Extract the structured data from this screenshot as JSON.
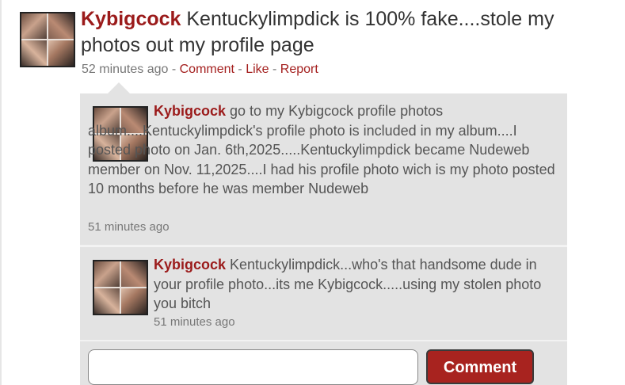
{
  "post": {
    "author": "Kybigcock",
    "text": " Kentuckylimpdick is 100% fake....stole my photos out my profile page",
    "time": "52 minutes ago",
    "sep": " - ",
    "actions": {
      "comment": "Comment",
      "like": "Like",
      "report": "Report"
    }
  },
  "comments": [
    {
      "author": "Kybigcock",
      "text": " go to my Kybigcock profile photos album....Kentuckylimpdick's profile photo is included in my album....I posted photo on Jan. 6th,2025.....Kentuckylimpdick became Nudeweb member on Nov. 11,2025....I had his profile photo wich is my photo posted 10 months before he was member Nudeweb",
      "time": "51 minutes ago"
    },
    {
      "author": "Kybigcock",
      "text": " Kentuckylimpdick...who's that handsome dude in your profile photo...its me Kybigcock.....using my stolen photo you bitch",
      "time": "51 minutes ago"
    }
  ],
  "reply": {
    "placeholder": "",
    "button_label": "Comment"
  },
  "colors": {
    "author": "#9b1b1b",
    "link": "#a4201f",
    "button_bg": "#a8231f",
    "comment_bg": "#e3e3e3"
  }
}
